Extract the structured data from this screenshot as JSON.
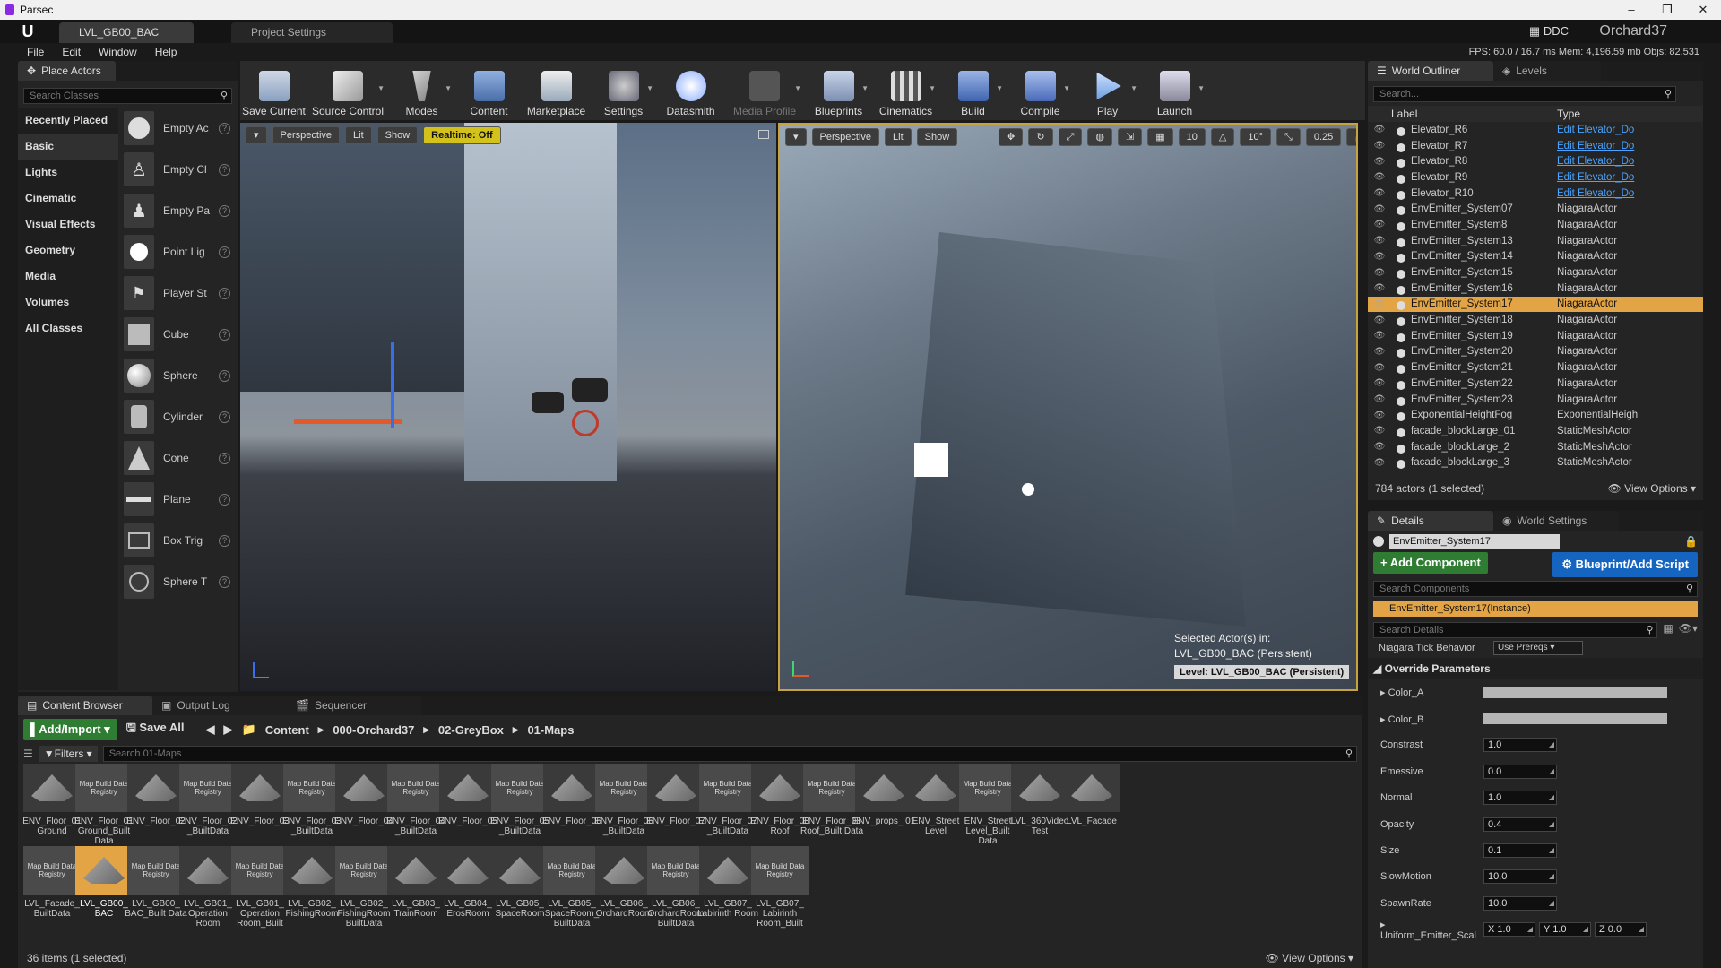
{
  "parsec": {
    "title": "Parsec",
    "controls": [
      "–",
      "❐",
      "✕"
    ]
  },
  "ue_tabs": [
    {
      "label": "LVL_GB00_BAC"
    },
    {
      "label": "Project Settings"
    }
  ],
  "ddc": "DDC",
  "project_name": "Orchard37",
  "menus": [
    "File",
    "Edit",
    "Window",
    "Help"
  ],
  "stats": "FPS: 60.0  /  16.7 ms   Mem: 4,196.59 mb   Objs: 82,531",
  "place": {
    "tab": "Place Actors",
    "search_placeholder": "Search Classes",
    "categories": [
      "Recently Placed",
      "Basic",
      "Lights",
      "Cinematic",
      "Visual Effects",
      "Geometry",
      "Media",
      "Volumes",
      "All Classes"
    ],
    "actors": [
      "Empty Ac",
      "Empty Cl",
      "Empty Pa",
      "Point Lig",
      "Player St",
      "Cube",
      "Sphere",
      "Cylinder",
      "Cone",
      "Plane",
      "Box Trig",
      "Sphere T"
    ]
  },
  "toolbar": [
    "Save Current",
    "Source Control",
    "Modes",
    "Content",
    "Marketplace",
    "Settings",
    "Datasmith",
    "Media Profile",
    "Blueprints",
    "Cinematics",
    "Build",
    "Compile",
    "Play",
    "Launch"
  ],
  "vp1": {
    "perspective": "Perspective",
    "lit": "Lit",
    "show": "Show",
    "realtime": "Realtime: Off"
  },
  "vp2": {
    "perspective": "Perspective",
    "lit": "Lit",
    "show": "Show",
    "grid": "10",
    "angle": "10°",
    "scale": "0.25",
    "cams": "4",
    "selected": "Selected Actor(s) in:",
    "level_name": "LVL_GB00_BAC (Persistent)",
    "level_badge": "Level:  LVL_GB00_BAC (Persistent)"
  },
  "outliner": {
    "tabs": [
      "World Outliner",
      "Levels"
    ],
    "search_placeholder": "Search...",
    "col_label": "Label",
    "col_type": "Type",
    "rows": [
      {
        "name": "Elevator_R6",
        "type": "Edit Elevator_Do",
        "link": true
      },
      {
        "name": "Elevator_R7",
        "type": "Edit Elevator_Do",
        "link": true
      },
      {
        "name": "Elevator_R8",
        "type": "Edit Elevator_Do",
        "link": true
      },
      {
        "name": "Elevator_R9",
        "type": "Edit Elevator_Do",
        "link": true
      },
      {
        "name": "Elevator_R10",
        "type": "Edit Elevator_Do",
        "link": true
      },
      {
        "name": "EnvEmitter_System07",
        "type": "NiagaraActor"
      },
      {
        "name": "EnvEmitter_System8",
        "type": "NiagaraActor"
      },
      {
        "name": "EnvEmitter_System13",
        "type": "NiagaraActor"
      },
      {
        "name": "EnvEmitter_System14",
        "type": "NiagaraActor"
      },
      {
        "name": "EnvEmitter_System15",
        "type": "NiagaraActor"
      },
      {
        "name": "EnvEmitter_System16",
        "type": "NiagaraActor"
      },
      {
        "name": "EnvEmitter_System17",
        "type": "NiagaraActor",
        "sel": true
      },
      {
        "name": "EnvEmitter_System18",
        "type": "NiagaraActor"
      },
      {
        "name": "EnvEmitter_System19",
        "type": "NiagaraActor"
      },
      {
        "name": "EnvEmitter_System20",
        "type": "NiagaraActor"
      },
      {
        "name": "EnvEmitter_System21",
        "type": "NiagaraActor"
      },
      {
        "name": "EnvEmitter_System22",
        "type": "NiagaraActor"
      },
      {
        "name": "EnvEmitter_System23",
        "type": "NiagaraActor"
      },
      {
        "name": "ExponentialHeightFog",
        "type": "ExponentialHeigh"
      },
      {
        "name": "facade_blockLarge_01",
        "type": "StaticMeshActor"
      },
      {
        "name": "facade_blockLarge_2",
        "type": "StaticMeshActor"
      },
      {
        "name": "facade_blockLarge_3",
        "type": "StaticMeshActor"
      }
    ],
    "footer": "784 actors (1 selected)",
    "view_options": "View Options"
  },
  "details": {
    "tabs": [
      "Details",
      "World Settings"
    ],
    "name": "EnvEmitter_System17",
    "add_component": "+ Add Component",
    "blueprint": "Blueprint/Add Script",
    "search_components": "Search Components",
    "instance": "EnvEmitter_System17(Instance)",
    "search_details": "Search Details",
    "tick_label": "Niagara Tick Behavior",
    "tick_value": "Use Prereqs",
    "section": "Override Parameters",
    "color_a": "Color_A",
    "color_b": "Color_B",
    "params": [
      {
        "label": "Constrast",
        "value": "1.0"
      },
      {
        "label": "Emessive",
        "value": "0.0"
      },
      {
        "label": "Normal",
        "value": "1.0"
      },
      {
        "label": "Opacity",
        "value": "0.4"
      },
      {
        "label": "Size",
        "value": "0.1"
      },
      {
        "label": "SlowMotion",
        "value": "10.0"
      },
      {
        "label": "SpawnRate",
        "value": "10.0"
      }
    ],
    "uniform_label": "Uniform_Emitter_Scal",
    "uniform": {
      "x": "X  1.0",
      "y": "Y  1.0",
      "z": "Z  0.0"
    }
  },
  "content": {
    "tabs": [
      "Content Browser",
      "Output Log",
      "Sequencer"
    ],
    "add_import": "Add/Import",
    "save_all": "Save All",
    "path": [
      "Content",
      "000-Orchard37",
      "02-GreyBox",
      "01-Maps"
    ],
    "filters": "Filters",
    "search_placeholder": "Search 01-Maps",
    "registry_label": "Map Build Data Registry",
    "row1": [
      {
        "label": "ENV_Floor_01 Ground",
        "kind": "map"
      },
      {
        "label": "ENV_Floor_01 Ground_Built Data",
        "kind": "reg"
      },
      {
        "label": "ENV_Floor_02",
        "kind": "map"
      },
      {
        "label": "ENV_Floor_02 _BuiltData",
        "kind": "reg"
      },
      {
        "label": "ENV_Floor_03",
        "kind": "map"
      },
      {
        "label": "ENV_Floor_03 _BuiltData",
        "kind": "reg"
      },
      {
        "label": "ENV_Floor_04",
        "kind": "map"
      },
      {
        "label": "ENV_Floor_04 _BuiltData",
        "kind": "reg"
      },
      {
        "label": "ENV_Floor_05",
        "kind": "map"
      },
      {
        "label": "ENV_Floor_05 _BuiltData",
        "kind": "reg"
      },
      {
        "label": "ENV_Floor_06",
        "kind": "map"
      },
      {
        "label": "ENV_Floor_06 _BuiltData",
        "kind": "reg"
      },
      {
        "label": "ENV_Floor_07",
        "kind": "map"
      },
      {
        "label": "ENV_Floor_07 _BuiltData",
        "kind": "reg"
      },
      {
        "label": "ENV_Floor_08 Roof",
        "kind": "map"
      },
      {
        "label": "ENV_Floor_08 Roof_Built Data",
        "kind": "reg"
      },
      {
        "label": "ENV_props_ 01",
        "kind": "map"
      },
      {
        "label": "ENV_Street Level",
        "kind": "map"
      },
      {
        "label": "ENV_Street Level_Built Data",
        "kind": "reg"
      },
      {
        "label": "LVL_360Video Test",
        "kind": "map"
      },
      {
        "label": "LVL_Facade",
        "kind": "map"
      }
    ],
    "row2": [
      {
        "label": "LVL_Facade_ BuiltData",
        "kind": "reg"
      },
      {
        "label": "LVL_GB00_ BAC",
        "kind": "map",
        "sel": true
      },
      {
        "label": "LVL_GB00_ BAC_Built Data",
        "kind": "reg"
      },
      {
        "label": "LVL_GB01_ Operation Room",
        "kind": "map"
      },
      {
        "label": "LVL_GB01_ Operation Room_Built",
        "kind": "reg"
      },
      {
        "label": "LVL_GB02_ FishingRoom",
        "kind": "map"
      },
      {
        "label": "LVL_GB02_ FishingRoom BuiltData",
        "kind": "reg"
      },
      {
        "label": "LVL_GB03_ TrainRoom",
        "kind": "map"
      },
      {
        "label": "LVL_GB04_ ErosRoom",
        "kind": "map"
      },
      {
        "label": "LVL_GB05_ SpaceRoom",
        "kind": "map"
      },
      {
        "label": "LVL_GB05_ SpaceRoom_ BuiltData",
        "kind": "reg"
      },
      {
        "label": "LVL_GB06_ OrchardRoom",
        "kind": "map"
      },
      {
        "label": "LVL_GB06_ OrchardRoom BuiltData",
        "kind": "reg"
      },
      {
        "label": "LVL_GB07_ Labirinth Room",
        "kind": "map"
      },
      {
        "label": "LVL_GB07_ Labirinth Room_Built",
        "kind": "reg"
      }
    ],
    "footer": "36 items (1 selected)",
    "view_options": "View Options"
  }
}
